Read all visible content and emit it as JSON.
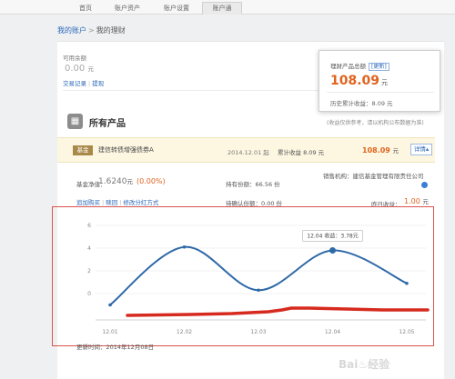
{
  "nav": {
    "tabs": [
      {
        "label": "首页",
        "active": false
      },
      {
        "label": "账户资产",
        "active": false
      },
      {
        "label": "账户设置",
        "active": false
      },
      {
        "label": "账户通",
        "active": true
      }
    ]
  },
  "breadcrumb": {
    "root": "我的账户",
    "sep": ">",
    "current": "我的理财"
  },
  "available": {
    "label": "可用余额",
    "value": "0.00",
    "unit": "元",
    "link_records": "交易记录",
    "link_sep": "|",
    "link_withdraw": "提现"
  },
  "summary": {
    "title": "理财产品总额",
    "update": "[更新]",
    "value": "108.09",
    "unit": "元",
    "history": "历史累计收益：8.09 元"
  },
  "section": {
    "icon": "▦",
    "title": "所有产品",
    "note": "(收益仅供参考，请以机构公布数据为准)"
  },
  "product": {
    "badge": "基金",
    "name": "建信转债增强债券A",
    "date": "2014.12.01 起",
    "cum_label": "累计收益 8.09 元",
    "amount": "108.09",
    "amount_unit": "元",
    "detail": "详情",
    "nav_label": "基金净值：",
    "nav_value": "1.6240",
    "nav_unit": "元",
    "nav_pct": "(0.00%)",
    "holding": "持有份额：66.56 份",
    "pending": "待确认份额：0.00 份",
    "seller": "销售机构：建信基金管理有限责任公司",
    "yesterday_label": "昨日收益：",
    "yesterday_value": "1.00",
    "yesterday_unit": "元",
    "links": [
      "追加购买",
      "赎回",
      "修改分红方式"
    ],
    "link_sep": "|"
  },
  "chart_data": {
    "type": "line",
    "categories": [
      "12.01",
      "12.02",
      "12.03",
      "12.04",
      "12.05"
    ],
    "yticks": [
      "6",
      "4",
      "2",
      "0"
    ],
    "ylim": [
      -2,
      6.6
    ],
    "series": [
      {
        "values": [
          -1.0,
          4.1,
          0.3,
          3.8,
          0.9
        ],
        "color": "#2f69a8"
      }
    ],
    "tooltip": "12.04 收益：3.78元",
    "tooltip_index": 3,
    "update_time": "更新时间：2014年12月08日"
  },
  "watermark": "Bai♨经验",
  "colors": {
    "accent": "#e0631e",
    "link": "#2a66b8",
    "line": "#2f69a8",
    "annotation": "#d62a1e"
  }
}
